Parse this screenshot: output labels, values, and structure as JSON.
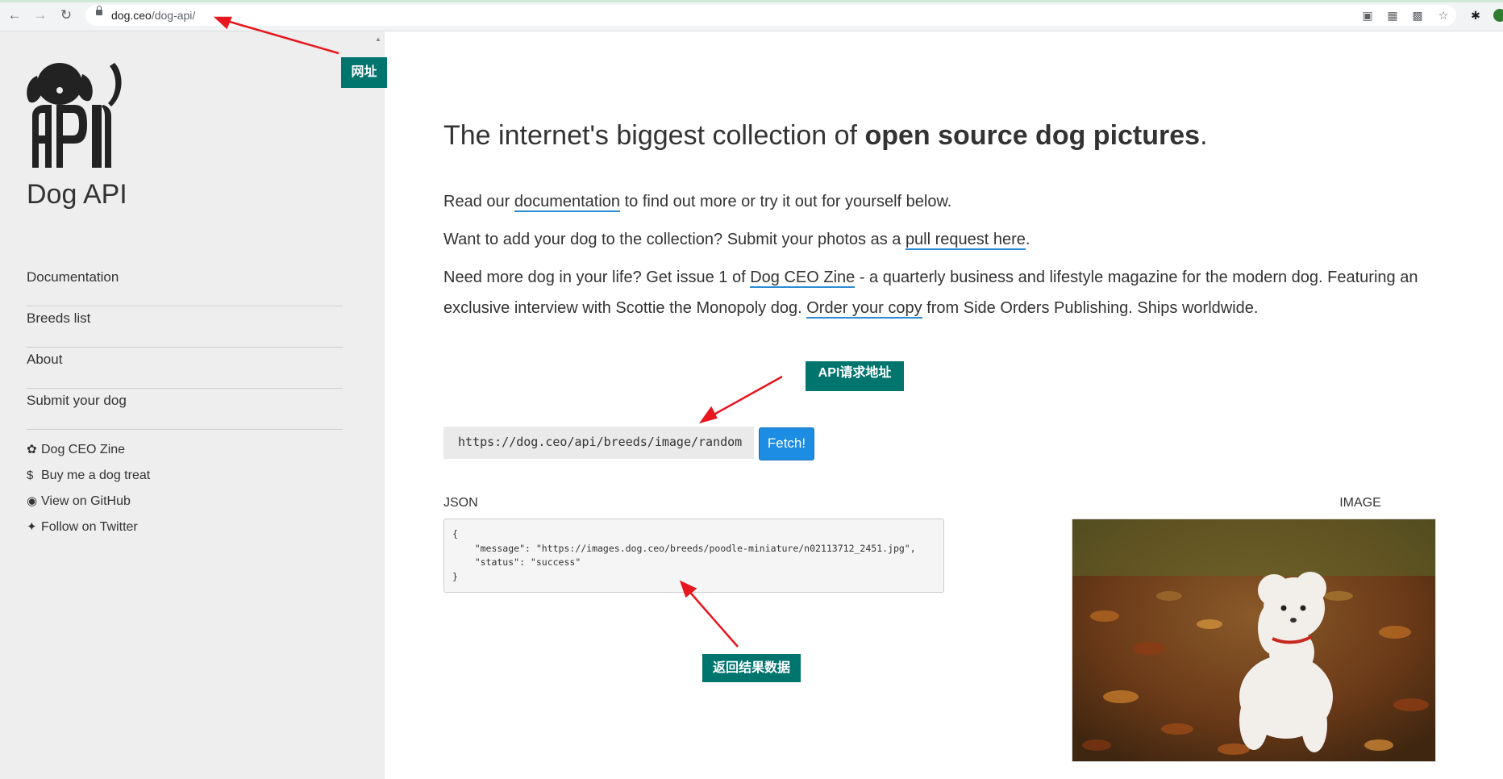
{
  "browser": {
    "url_domain": "dog.ceo",
    "url_path": "/dog-api/"
  },
  "sidebar": {
    "brand": "Dog API",
    "nav": [
      {
        "label": "Documentation"
      },
      {
        "label": "Breeds list"
      },
      {
        "label": "About"
      },
      {
        "label": "Submit your dog"
      }
    ],
    "links": [
      {
        "icon": "paw-icon",
        "label": "Dog CEO Zine"
      },
      {
        "icon": "dollar-icon",
        "label": "Buy me a dog treat"
      },
      {
        "icon": "github-icon",
        "label": "View on GitHub"
      },
      {
        "icon": "twitter-icon",
        "label": "Follow on Twitter"
      }
    ]
  },
  "main": {
    "headline_start": "The internet's biggest collection of ",
    "headline_bold": "open source dog pictures",
    "headline_end": ".",
    "p1_start": "Read our ",
    "p1_link": "documentation",
    "p1_end": " to find out more or try it out for yourself below.",
    "p2_start": "Want to add your dog to the collection? Submit your photos as a ",
    "p2_link": "pull request here",
    "p2_end": ".",
    "p3_start": "Need more dog in your life? Get issue 1 of ",
    "p3_link": "Dog CEO Zine",
    "p3_mid": " - a quarterly business and lifestyle magazine for the modern dog. Featuring an",
    "p3_line2_start": "exclusive interview with Scottie the Monopoly dog. ",
    "p3_link2": "Order your copy",
    "p3_end": " from Side Orders Publishing. Ships worldwide.",
    "api_url": "https://dog.ceo/api/breeds/image/random",
    "fetch_label": "Fetch!",
    "json_label": "JSON",
    "json_text": "{\n    \"message\": \"https://images.dog.ceo/breeds/poodle-miniature/n02113712_2451.jpg\",\n    \"status\": \"success\"\n}",
    "image_label": "IMAGE"
  },
  "annotations": {
    "url_callout": "网址",
    "api_callout": "API请求地址",
    "result_callout": "返回结果数据"
  },
  "colors": {
    "accent": "#1d8de3",
    "link_underline": "#2b8cd6",
    "callout": "#00756e",
    "arrow": "#e8161e",
    "sidebar_bg": "#eeeeee"
  }
}
